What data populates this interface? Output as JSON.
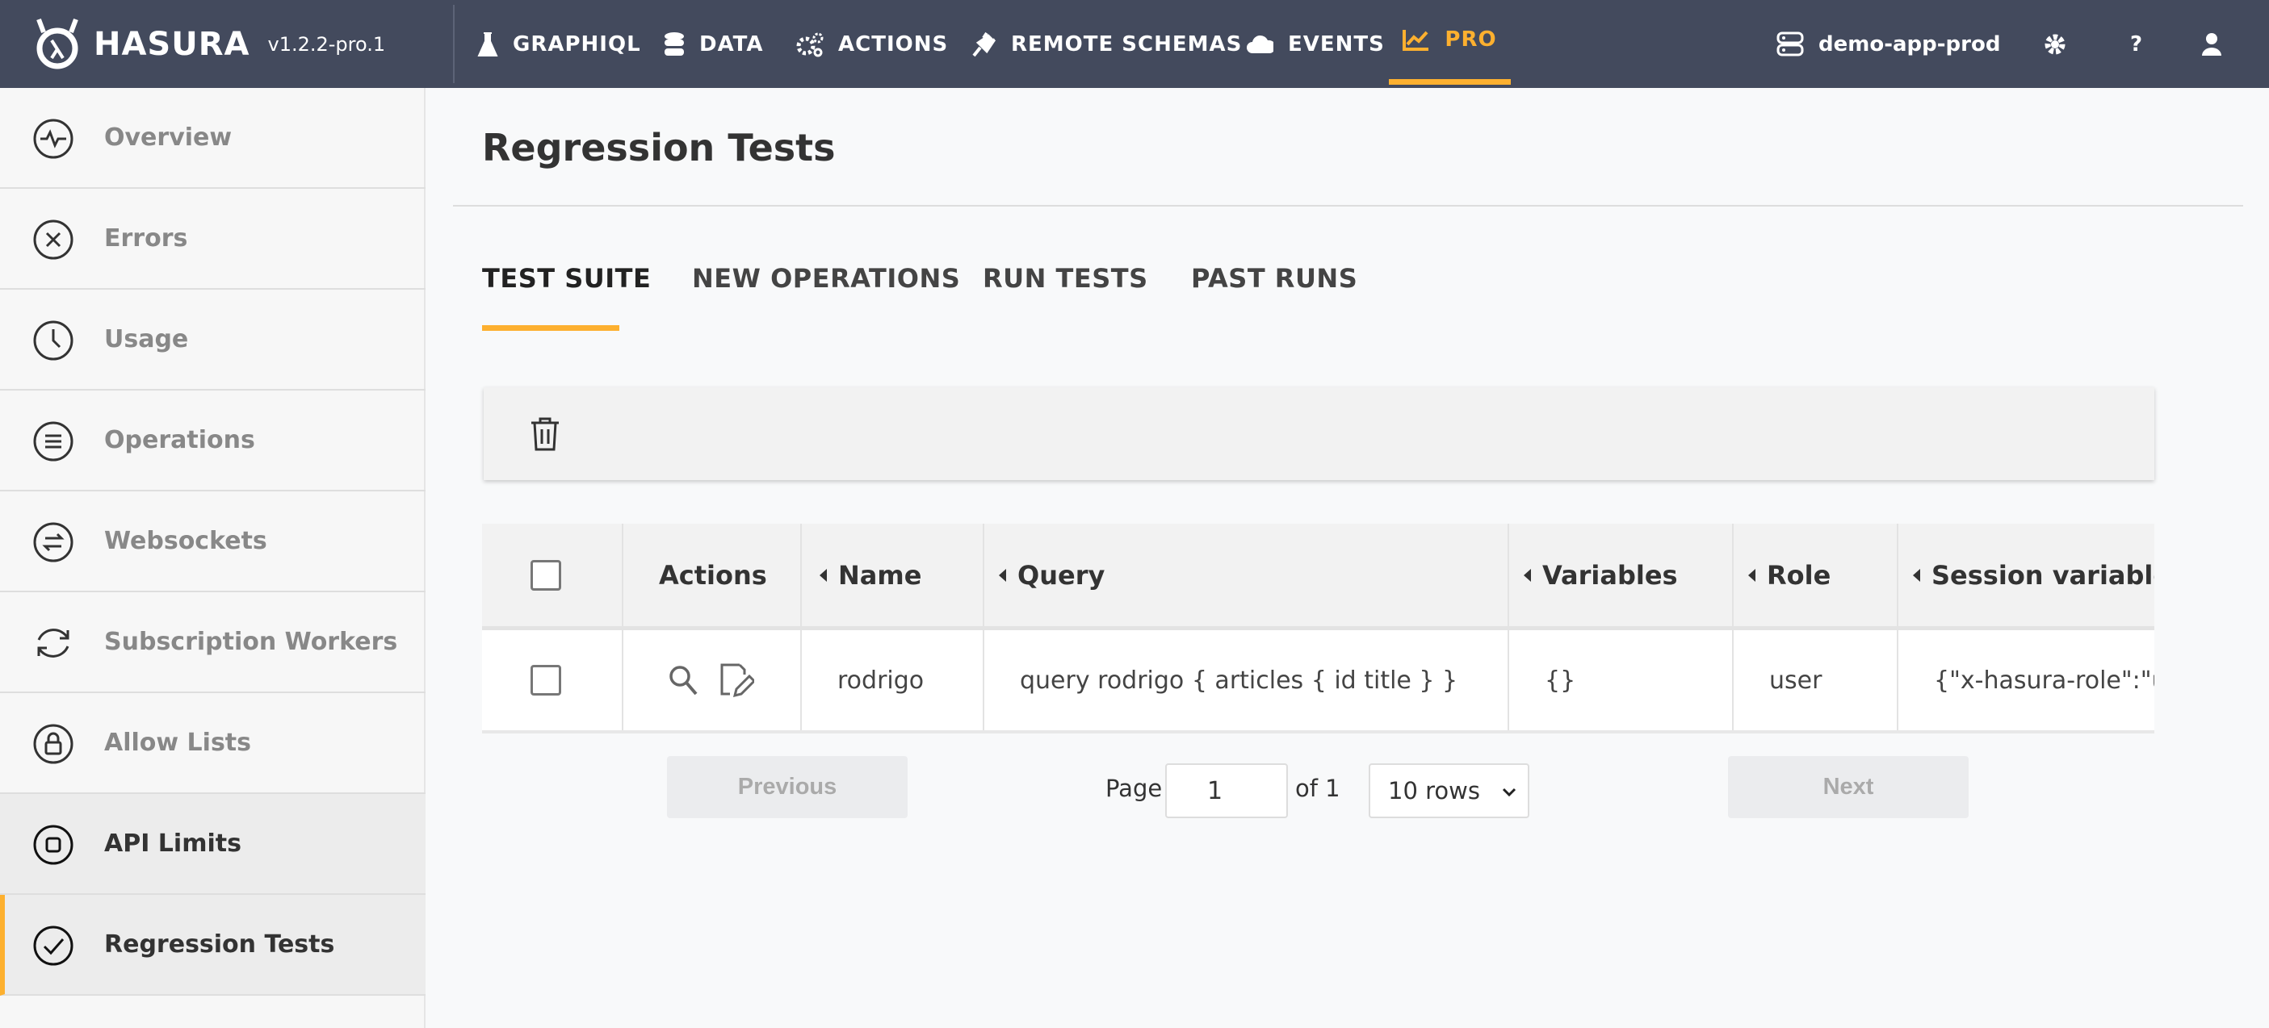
{
  "header": {
    "brand": "HASURA",
    "version": "v1.2.2-pro.1",
    "nav": [
      {
        "label": "GRAPHIQL",
        "icon": "flask-icon"
      },
      {
        "label": "DATA",
        "icon": "database-icon"
      },
      {
        "label": "ACTIONS",
        "icon": "cogs-icon"
      },
      {
        "label": "REMOTE SCHEMAS",
        "icon": "plug-icon"
      },
      {
        "label": "EVENTS",
        "icon": "cloud-icon"
      },
      {
        "label": "PRO",
        "icon": "chart-line-icon"
      }
    ],
    "project": "demo-app-prod",
    "help": "?"
  },
  "sidebar": {
    "items": [
      {
        "label": "Overview"
      },
      {
        "label": "Errors"
      },
      {
        "label": "Usage"
      },
      {
        "label": "Operations"
      },
      {
        "label": "Websockets"
      },
      {
        "label": "Subscription Workers"
      },
      {
        "label": "Allow Lists"
      },
      {
        "label": "API Limits"
      },
      {
        "label": "Regression Tests"
      }
    ]
  },
  "main": {
    "title": "Regression Tests",
    "tabs": [
      "TEST SUITE",
      "NEW OPERATIONS",
      "RUN TESTS",
      "PAST RUNS"
    ],
    "table": {
      "columns": [
        "Actions",
        "Name",
        "Query",
        "Variables",
        "Role",
        "Session variables"
      ],
      "rows": [
        {
          "name": "rodrigo",
          "query": "query rodrigo { articles { id title } }",
          "variables": "{}",
          "role": "user",
          "session": "{\"x-hasura-role\":\"user"
        }
      ]
    },
    "pagination": {
      "previous": "Previous",
      "page_label": "Page",
      "page": "1",
      "of": "of 1",
      "rows": "10 rows",
      "next": "Next"
    }
  },
  "colors": {
    "accent": "#fdb02f",
    "header_bg": "#434a5d"
  }
}
